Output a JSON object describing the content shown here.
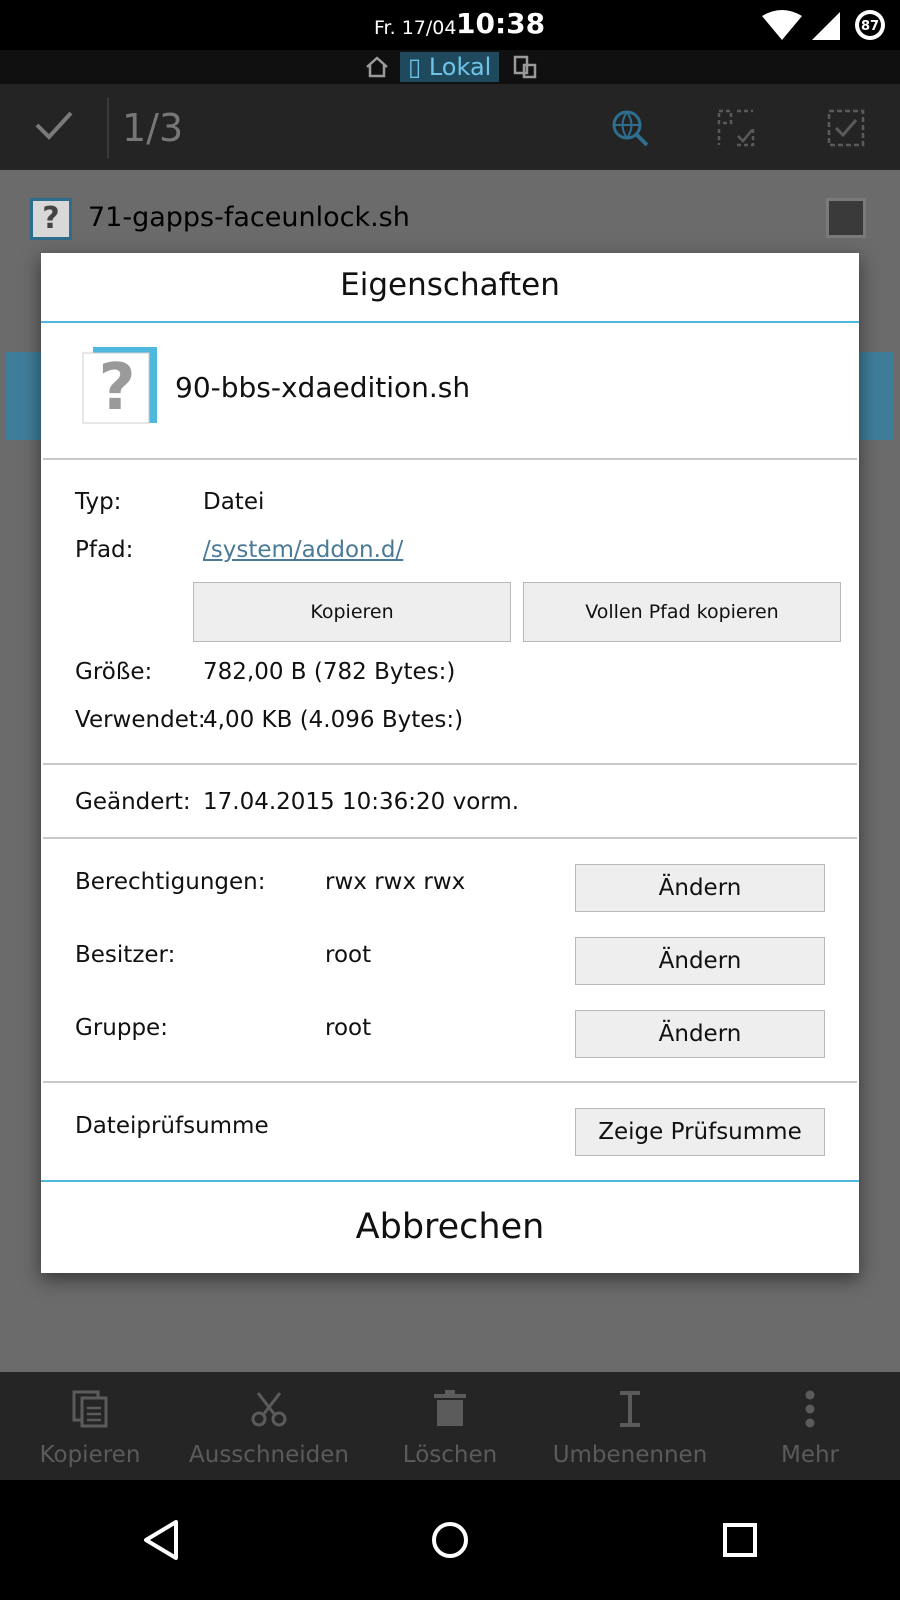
{
  "status": {
    "date": "Fr. 17/04",
    "time": "10:38",
    "battery": "87"
  },
  "location": {
    "tab_label": "Lokal"
  },
  "actionbar": {
    "selection_count": "1/3"
  },
  "list": {
    "first_file": "71-gapps-faceunlock.sh"
  },
  "dialog": {
    "title": "Eigenschaften",
    "filename": "90-bbs-xdaedition.sh",
    "type_label": "Typ:",
    "type_value": "Datei",
    "path_label": "Pfad:",
    "path_value": "/system/addon.d/",
    "copy_button": "Kopieren",
    "copy_full_path_button": "Vollen Pfad kopieren",
    "size_label": "Größe:",
    "size_value": "782,00 B (782 Bytes:)",
    "used_label": "Verwendet:",
    "used_value": "4,00 KB (4.096 Bytes:)",
    "modified_label": "Geändert:",
    "modified_value": "17.04.2015 10:36:20 vorm.",
    "permissions_label": "Berechtigungen:",
    "permissions_value": "rwx rwx rwx",
    "owner_label": "Besitzer:",
    "owner_value": "root",
    "group_label": "Gruppe:",
    "group_value": "root",
    "change_button": "Ändern",
    "checksum_label": "Dateiprüfsumme",
    "checksum_button": "Zeige Prüfsumme",
    "cancel_button": "Abbrechen"
  },
  "toolbar": {
    "copy": "Kopieren",
    "cut": "Ausschneiden",
    "delete": "Löschen",
    "rename": "Umbenennen",
    "more": "Mehr"
  },
  "colors": {
    "accent": "#4fb8de",
    "link": "#4a7a96",
    "dim_background": "#6b6b6b"
  }
}
